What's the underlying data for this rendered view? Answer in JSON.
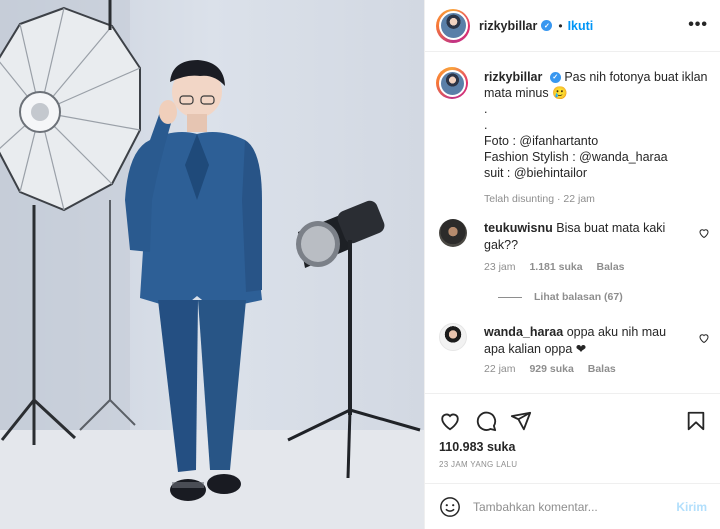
{
  "post": {
    "username": "rizkybillar",
    "follow_label": "Ikuti",
    "separator": "•",
    "more_label": "•••"
  },
  "caption": {
    "username": "rizkybillar",
    "text_lines": [
      "Pas nih fotonya buat iklan mata minus 🥲",
      ".",
      ".",
      "Foto : @ifanhartanto",
      "Fashion Stylish : @wanda_haraa",
      "suit : @biehintailor"
    ],
    "edited_label": "Telah disunting",
    "time": "22 jam",
    "meta_sep": "·"
  },
  "comments": [
    {
      "username": "teukuwisnu",
      "text": "Bisa buat mata kaki gak??",
      "time": "23 jam",
      "likes": "1.181 suka",
      "reply_label": "Balas",
      "view_replies": "Lihat balasan (67)",
      "avatar": "teuku-avatar"
    },
    {
      "username": "wanda_haraa",
      "text": "oppa aku nih mau apa kalian oppa ❤",
      "time": "22 jam",
      "likes": "929 suka",
      "reply_label": "Balas",
      "avatar": "wanda-avatar"
    }
  ],
  "actions": {
    "likes_count": "110.983 suka",
    "time_ago": "23 JAM YANG LALU",
    "icons": [
      "heart-icon",
      "comment-icon",
      "share-icon",
      "bookmark-icon"
    ]
  },
  "add_comment": {
    "placeholder": "Tambahkan komentar...",
    "post_label": "Kirim"
  },
  "colors": {
    "link_blue": "#0095f6",
    "verified_blue": "#3897f0",
    "muted_text": "#8e8e8e",
    "suit_blue": "#2d5f96"
  }
}
